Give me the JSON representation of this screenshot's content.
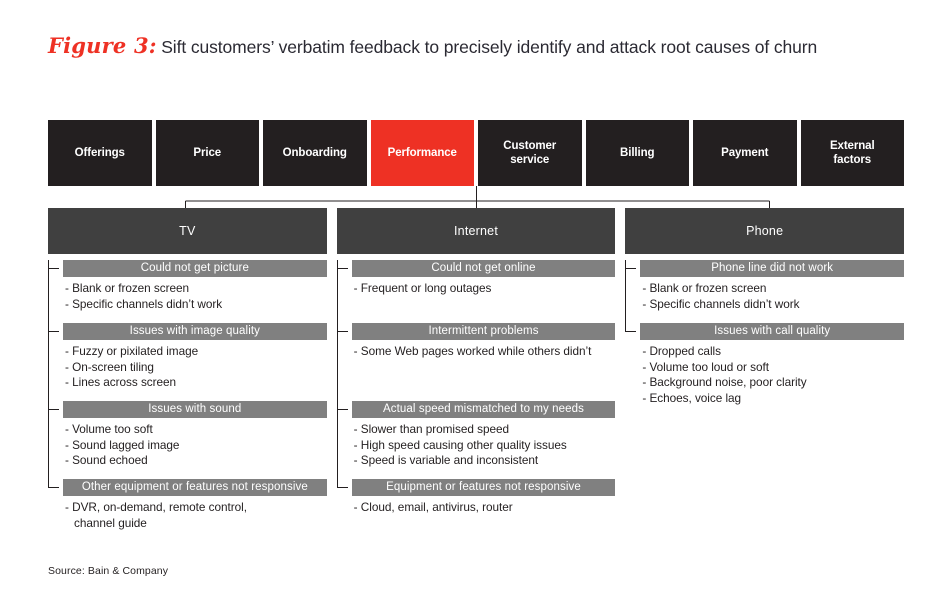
{
  "figure": {
    "label": "Figure 3:",
    "title": "Sift customers’ verbatim feedback to precisely identify and attack root causes of churn"
  },
  "colors": {
    "accent_red": "#ee3124",
    "box_black": "#231f20",
    "header_gray": "#404040",
    "bar_gray": "#808080",
    "text_dark": "#231f20"
  },
  "categories": [
    {
      "label": "Offerings",
      "active": false
    },
    {
      "label": "Price",
      "active": false
    },
    {
      "label": "Onboarding",
      "active": false
    },
    {
      "label": "Performance",
      "active": true
    },
    {
      "label": "Customer\nservice",
      "active": false
    },
    {
      "label": "Billing",
      "active": false
    },
    {
      "label": "Payment",
      "active": false
    },
    {
      "label": "External\nfactors",
      "active": false
    }
  ],
  "services": [
    {
      "name": "TV",
      "groups": [
        {
          "bar": "Could not get picture",
          "items": [
            "- Blank or frozen screen",
            "- Specific channels didn’t work"
          ]
        },
        {
          "bar": "Issues with image quality",
          "items": [
            "- Fuzzy or pixilated image",
            "- On-screen tiling",
            "- Lines across screen"
          ]
        },
        {
          "bar": "Issues with sound",
          "items": [
            "- Volume too soft",
            "- Sound lagged image",
            "- Sound echoed"
          ]
        },
        {
          "bar": "Other equipment or features not responsive",
          "items": [
            "- DVR, on-demand, remote control,\n  channel guide"
          ]
        }
      ]
    },
    {
      "name": "Internet",
      "groups": [
        {
          "bar": "Could not get online",
          "items": [
            "- Frequent or long outages"
          ]
        },
        {
          "bar": "Intermittent problems",
          "items": [
            "- Some Web pages worked while others didn’t"
          ]
        },
        {
          "bar": "Actual speed mismatched to my needs",
          "items": [
            "- Slower than promised speed",
            "- High speed causing other quality issues",
            "- Speed is variable and inconsistent"
          ]
        },
        {
          "bar": "Equipment or features not responsive",
          "items": [
            "- Cloud, email, antivirus, router"
          ]
        }
      ]
    },
    {
      "name": "Phone",
      "groups": [
        {
          "bar": "Phone line did not work",
          "items": [
            "- Blank or frozen screen",
            "- Specific channels didn’t work"
          ]
        },
        {
          "bar": "Issues with call quality",
          "items": [
            "- Dropped calls",
            "- Volume too loud or soft",
            "- Background noise, poor clarity",
            "- Echoes, voice lag"
          ]
        }
      ]
    }
  ],
  "source": "Source: Bain & Company"
}
